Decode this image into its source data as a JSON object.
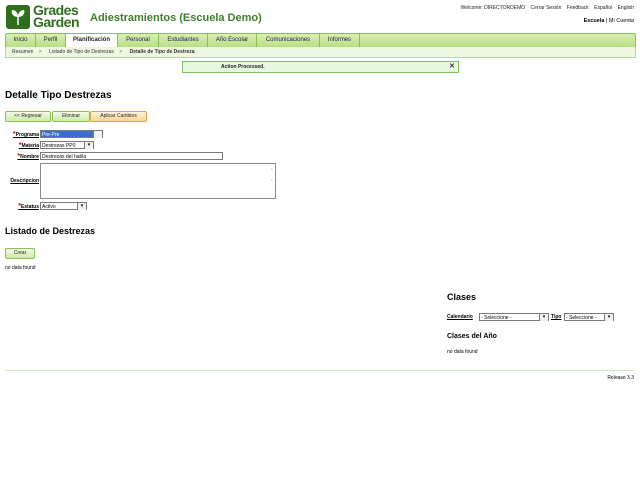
{
  "header": {
    "logo_line1": "Grades",
    "logo_line2": "Garden",
    "app_title": "Adiestramientos (Escuela Demo)",
    "welcome": "Welcome: DIRECTORDEMO",
    "links": [
      "Cerrar Sesión",
      "Feedback",
      "Español",
      "English"
    ],
    "school": "Escuela",
    "my_account": "Mi Cuenta"
  },
  "nav": {
    "tabs": [
      "Inicio",
      "Perfil",
      "Planificación",
      "Personal",
      "Estudiantes",
      "Año Escolar",
      "Comunicaciones",
      "Informes"
    ],
    "active": "Planificación"
  },
  "breadcrumb": [
    "Resumen",
    "Listado de Tipo de Destrezas",
    "Detalle de Tipo de Destreza"
  ],
  "message": "Action Processed.",
  "page_title": "Detalle Tipo Destrezas",
  "buttons": {
    "back": "<< Regresar",
    "delete": "Eliminar",
    "apply": "Aplicar Cambios"
  },
  "form": {
    "programa_label": "Programa",
    "programa_value": "Pre-Pre",
    "materia_label": "Materia",
    "materia_value": "Destrezas PP0",
    "nombre_label": "Nombre",
    "nombre_value": "Destrezas del habla",
    "descripcion_label": "Descripcion",
    "estatus_label": "Estatus",
    "estatus_value": "Activo"
  },
  "list": {
    "title": "Listado de Destrezas",
    "create": "Crear",
    "empty": "no data found"
  },
  "clases": {
    "title": "Clases",
    "calendario_label": "Calendario",
    "calendario_value": "- Seleccione -",
    "tipo_label": "Tipo",
    "tipo_value": "- Seleccione -",
    "year_title": "Clases del Año",
    "empty": "no data found"
  },
  "footer": {
    "release": "Release 3.3"
  }
}
